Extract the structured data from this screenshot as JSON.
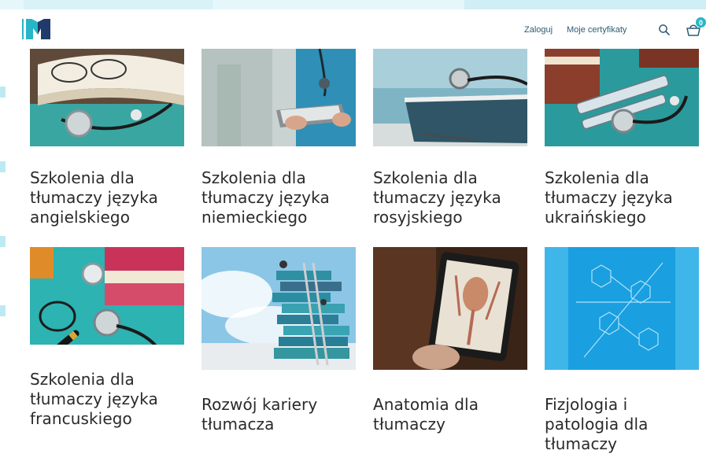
{
  "header": {
    "logo_text": "MD",
    "login_label": "Zaloguj",
    "certificates_label": "Moje certyfikaty",
    "cart_count": "0",
    "search_icon": "search-icon",
    "cart_icon": "basket-icon"
  },
  "colors": {
    "brand_teal": "#27b6c7",
    "brand_navy": "#1f3a6b",
    "nav_text": "#2d5b73"
  },
  "cards": [
    {
      "lines": [
        "Szkolenia dla",
        "tłumaczy języka",
        "angielskiego"
      ]
    },
    {
      "lines": [
        "Szkolenia dla",
        "tłumaczy języka",
        "niemieckiego"
      ]
    },
    {
      "lines": [
        "Szkolenia dla",
        "tłumaczy języka",
        "rosyjskiego"
      ]
    },
    {
      "lines": [
        "Szkolenia dla",
        "tłumaczy języka",
        "ukraińskiego"
      ]
    },
    {
      "lines": [
        "Szkolenia dla",
        "tłumaczy języka",
        "francuskiego"
      ]
    },
    {
      "lines": [
        "Rozwój kariery",
        "tłumacza"
      ]
    },
    {
      "lines": [
        "Anatomia dla",
        "tłumaczy"
      ]
    },
    {
      "lines": [
        "Fizjologia i",
        "patologia dla",
        "tłumaczy"
      ]
    }
  ]
}
